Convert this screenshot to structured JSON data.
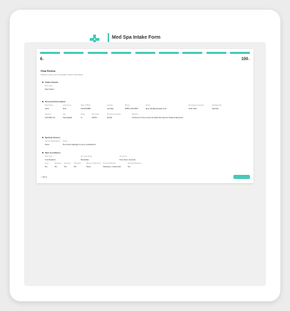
{
  "header": {
    "logo_text_prefix": "SERENITY",
    "logo_text_suffix": "SPA",
    "title": "Med Spa Intake Form",
    "subtitle": "Please complete this form to help us provide you with the best care."
  },
  "progress": {
    "step_total": 9,
    "step_label": "6",
    "step_suffix": "/9",
    "percent_label": "100",
    "percent_suffix": "%"
  },
  "review": {
    "title": "Final Review",
    "description": "Please review your information before submitting.",
    "sections": [
      {
        "heading": "Intake Details",
        "fields": [
          {
            "label": "Visit Type",
            "value": "New Client"
          }
        ]
      },
      {
        "heading": "Personal Information",
        "fields": [
          {
            "label": "First Name",
            "value": "Jane"
          },
          {
            "label": "Last Name",
            "value": "Doe"
          },
          {
            "label": "Date of Birth",
            "value": "01/15/1985"
          },
          {
            "label": "Gender",
            "value": "Female"
          },
          {
            "label": "Phone",
            "value": "(555) 123-4567"
          },
          {
            "label": "Email",
            "value": "jane.doe@example.com"
          },
          {
            "label": "Emergency Contact",
            "value": "John Doe"
          },
          {
            "label": "Relationship",
            "value": "Spouse"
          },
          {
            "label": "Address",
            "value": "123 Main St"
          },
          {
            "label": "City",
            "value": "Springfield"
          },
          {
            "label": "State",
            "value": "IL"
          },
          {
            "label": "Zip Code",
            "value": "62701"
          },
          {
            "label": "Preferred Contact",
            "value": "Email"
          },
          {
            "label": "Referral",
            "value": "A friend of mine recommended this spa for facial treatments"
          }
        ]
      },
      {
        "heading": "Medical History",
        "fields": [
          {
            "label": "Current Medications",
            "value": "None"
          },
          {
            "label": "Notes",
            "value": "No known allergies to any medications"
          }
        ]
      },
      {
        "heading": "Skin Conditions",
        "fields": [
          {
            "label": "Skin Type",
            "value": "Combination"
          },
          {
            "label": "Sun Sensitivity",
            "value": "Moderate"
          },
          {
            "label": "Concerns",
            "value": "Fine lines, dryness"
          },
          {
            "label": "Acne",
            "value": "No"
          },
          {
            "label": "Rosacea",
            "value": "No"
          },
          {
            "label": "Eczema",
            "value": "No"
          },
          {
            "label": "Psoriasis",
            "value": "No"
          },
          {
            "label": "Recent Treatments",
            "value": "None"
          },
          {
            "label": "Current Skincare",
            "value": "Cleanser, moisturizer"
          },
          {
            "label": "Pregnant/Nursing",
            "value": "No"
          }
        ]
      }
    ],
    "back_label": "< Back"
  },
  "colors": {
    "accent": "#47c9b8",
    "page_bg": "#ececec"
  }
}
